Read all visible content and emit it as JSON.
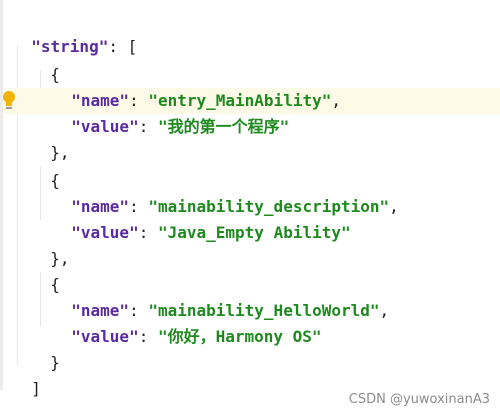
{
  "editor": {
    "root_key": "\"string\"",
    "colon": ": ",
    "comma": ",",
    "array_open": "[",
    "array_close": "]",
    "obj_open": "{",
    "obj_close": "}",
    "obj_close_comma": "},",
    "name_key": "\"name\"",
    "value_key": "\"value\"",
    "entries": [
      {
        "name": "\"entry_MainAbility\"",
        "value": "\"我的第一个程序\""
      },
      {
        "name": "\"mainability_description\"",
        "value": "\"Java_Empty Ability\""
      },
      {
        "name": "\"mainability_HelloWorld\"",
        "value": "\"你好，Harmony OS\""
      }
    ],
    "gutter_icon": "lightbulb-icon"
  },
  "watermark": "CSDN @yuwoxinanA3"
}
